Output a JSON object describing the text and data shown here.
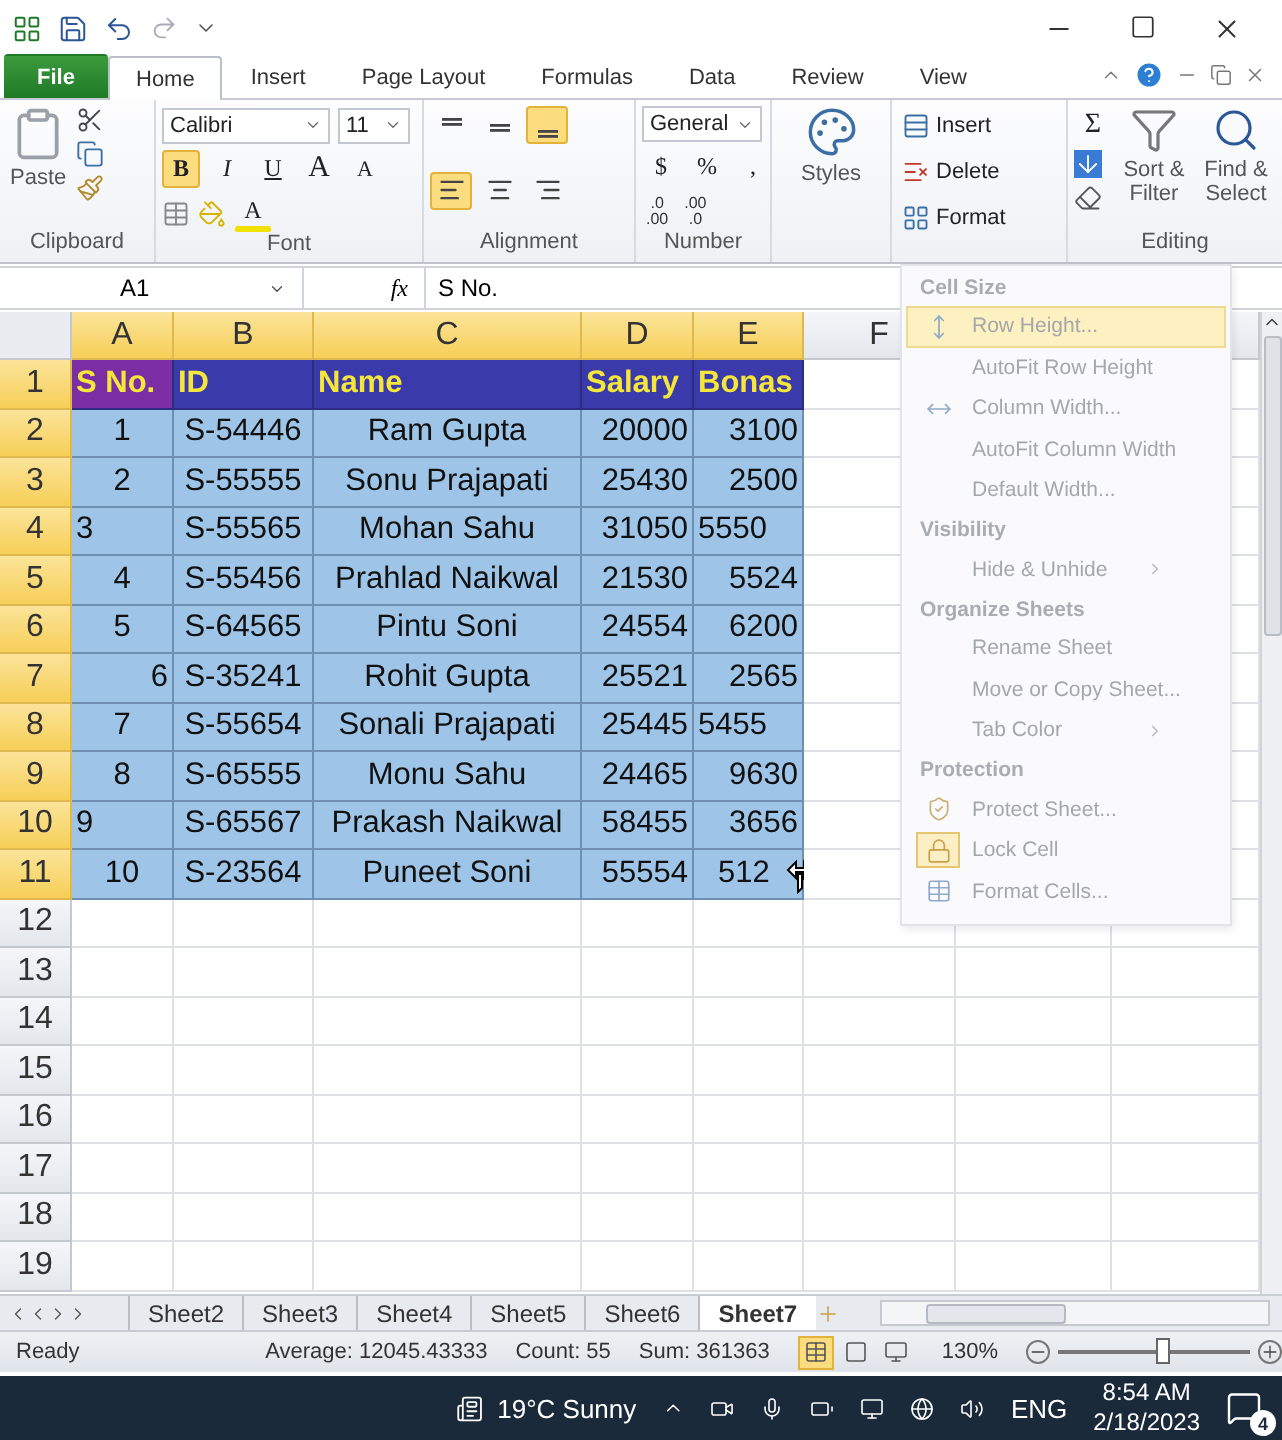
{
  "tabs": [
    {
      "label": "File",
      "kind": "file",
      "selected": false
    },
    {
      "label": "Home",
      "kind": "tab",
      "selected": true
    },
    {
      "label": "Insert",
      "kind": "tab",
      "selected": false
    },
    {
      "label": "Page Layout",
      "kind": "tab",
      "selected": false
    },
    {
      "label": "Formulas",
      "kind": "tab",
      "selected": false
    },
    {
      "label": "Data",
      "kind": "tab",
      "selected": false
    },
    {
      "label": "Review",
      "kind": "tab",
      "selected": false
    },
    {
      "label": "View",
      "kind": "tab",
      "selected": false
    }
  ],
  "ribbon": {
    "clipboard": {
      "label": "Clipboard",
      "paste": "Paste"
    },
    "font": {
      "label": "Font",
      "font_name": "Calibri",
      "font_size": "11",
      "bold": {
        "text": "B",
        "selected": true
      },
      "italic": {
        "text": "I",
        "selected": false
      },
      "underline": {
        "text": "U",
        "selected": false
      },
      "grow": "A",
      "shrink": "A",
      "font_color": "A"
    },
    "alignment": {
      "label": "Alignment",
      "buttons": [
        {
          "kind": "top",
          "selected": false
        },
        {
          "kind": "middle",
          "selected": false
        },
        {
          "kind": "bottom",
          "selected": true
        },
        {
          "kind": "left",
          "selected": true
        },
        {
          "kind": "center",
          "selected": false
        },
        {
          "kind": "right",
          "selected": false
        }
      ]
    },
    "number": {
      "label": "Number",
      "format": "General",
      "currency": "$",
      "percent": "%",
      "comma": ",",
      "decimals": [
        {
          "top": ".0",
          "bottom": ".00"
        },
        {
          "top": ".00",
          "bottom": ".0"
        }
      ]
    },
    "styles": {
      "label": "Styles"
    },
    "cells": {
      "items": [
        {
          "label": "Insert",
          "kind": "insert"
        },
        {
          "label": "Delete",
          "kind": "delete"
        },
        {
          "label": "Format",
          "kind": "format"
        }
      ]
    },
    "editing": {
      "label": "Editing",
      "sum": "Σ",
      "sort": "Sort & Filter",
      "find": "Find & Select"
    }
  },
  "name_box": "A1",
  "function_label": "fx",
  "formula": "S No.",
  "columns": [
    {
      "label": "A",
      "selected": true
    },
    {
      "label": "B",
      "selected": true
    },
    {
      "label": "C",
      "selected": true
    },
    {
      "label": "D",
      "selected": true
    },
    {
      "label": "E",
      "selected": true
    },
    {
      "label": "F",
      "selected": false
    }
  ],
  "rows": [
    {
      "number": "1",
      "selected": true,
      "kind": "header",
      "cells": [
        {
          "text": "S No.",
          "kind": "text",
          "active": true
        },
        {
          "text": "ID",
          "kind": "text",
          "active": false
        },
        {
          "text": "Name",
          "kind": "text",
          "active": false
        },
        {
          "text": "Salary",
          "kind": "text",
          "active": false
        },
        {
          "text": "Bonas",
          "kind": "text",
          "active": false
        }
      ]
    },
    {
      "number": "2",
      "selected": true,
      "kind": "data",
      "cells": [
        {
          "text": "1",
          "kind": "centered"
        },
        {
          "text": "S-54446",
          "kind": "centered"
        },
        {
          "text": "Ram Gupta",
          "kind": "centered"
        },
        {
          "text": "20000",
          "kind": "number"
        },
        {
          "text": "3100",
          "kind": "number"
        }
      ]
    },
    {
      "number": "3",
      "selected": true,
      "kind": "data",
      "cells": [
        {
          "text": "2",
          "kind": "centered"
        },
        {
          "text": "S-55555",
          "kind": "centered"
        },
        {
          "text": "Sonu Prajapati",
          "kind": "centered"
        },
        {
          "text": "25430",
          "kind": "number"
        },
        {
          "text": "2500",
          "kind": "number"
        }
      ]
    },
    {
      "number": "4",
      "selected": true,
      "kind": "data",
      "cells": [
        {
          "text": "3",
          "kind": "text"
        },
        {
          "text": "S-55565",
          "kind": "centered"
        },
        {
          "text": "Mohan Sahu",
          "kind": "centered"
        },
        {
          "text": "31050",
          "kind": "number"
        },
        {
          "text": "5550",
          "kind": "text"
        }
      ]
    },
    {
      "number": "5",
      "selected": true,
      "kind": "data",
      "cells": [
        {
          "text": "4",
          "kind": "centered"
        },
        {
          "text": "S-55456",
          "kind": "centered"
        },
        {
          "text": "Prahlad Naikwal",
          "kind": "centered"
        },
        {
          "text": "21530",
          "kind": "number"
        },
        {
          "text": "5524",
          "kind": "number"
        }
      ]
    },
    {
      "number": "6",
      "selected": true,
      "kind": "data",
      "cells": [
        {
          "text": "5",
          "kind": "centered"
        },
        {
          "text": "S-64565",
          "kind": "centered"
        },
        {
          "text": "Pintu Soni",
          "kind": "centered"
        },
        {
          "text": "24554",
          "kind": "number"
        },
        {
          "text": "6200",
          "kind": "number"
        }
      ]
    },
    {
      "number": "7",
      "selected": true,
      "kind": "data",
      "cells": [
        {
          "text": "6",
          "kind": "number"
        },
        {
          "text": "S-35241",
          "kind": "centered"
        },
        {
          "text": "Rohit Gupta",
          "kind": "centered"
        },
        {
          "text": "25521",
          "kind": "number"
        },
        {
          "text": "2565",
          "kind": "number"
        }
      ]
    },
    {
      "number": "8",
      "selected": true,
      "kind": "data",
      "cells": [
        {
          "text": "7",
          "kind": "centered"
        },
        {
          "text": "S-55654",
          "kind": "centered"
        },
        {
          "text": "Sonali Prajapati",
          "kind": "centered"
        },
        {
          "text": "25445",
          "kind": "number"
        },
        {
          "text": "5455",
          "kind": "text"
        }
      ]
    },
    {
      "number": "9",
      "selected": true,
      "kind": "data",
      "cells": [
        {
          "text": "8",
          "kind": "centered"
        },
        {
          "text": "S-65555",
          "kind": "centered"
        },
        {
          "text": "Monu Sahu",
          "kind": "centered"
        },
        {
          "text": "24465",
          "kind": "number"
        },
        {
          "text": "9630",
          "kind": "number"
        }
      ]
    },
    {
      "number": "10",
      "selected": true,
      "kind": "data",
      "cells": [
        {
          "text": "9",
          "kind": "text"
        },
        {
          "text": "S-65567",
          "kind": "centered"
        },
        {
          "text": "Prakash Naikwal",
          "kind": "centered"
        },
        {
          "text": "58455",
          "kind": "number"
        },
        {
          "text": "3656",
          "kind": "number"
        }
      ]
    },
    {
      "number": "11",
      "selected": true,
      "kind": "data",
      "cells": [
        {
          "text": "10",
          "kind": "centered"
        },
        {
          "text": "S-23564",
          "kind": "centered"
        },
        {
          "text": "Puneet Soni",
          "kind": "centered"
        },
        {
          "text": "55554",
          "kind": "number"
        },
        {
          "text": "512",
          "kind": "number"
        }
      ]
    },
    {
      "number": "12",
      "selected": false,
      "kind": "empty"
    },
    {
      "number": "13",
      "selected": false,
      "kind": "empty"
    },
    {
      "number": "14",
      "selected": false,
      "kind": "empty"
    },
    {
      "number": "15",
      "selected": false,
      "kind": "empty"
    },
    {
      "number": "16",
      "selected": false,
      "kind": "empty"
    },
    {
      "number": "17",
      "selected": false,
      "kind": "empty"
    },
    {
      "number": "18",
      "selected": false,
      "kind": "empty"
    },
    {
      "number": "19",
      "selected": false,
      "kind": "empty"
    }
  ],
  "format_menu": {
    "sections": [
      {
        "heading": "Cell Size",
        "items": [
          {
            "label": "Row Height...",
            "kind": "height",
            "selected": true,
            "checked": false,
            "submenu": false
          },
          {
            "label": "AutoFit Row Height",
            "kind": "plain",
            "selected": false,
            "checked": false,
            "submenu": false
          },
          {
            "label": "Column Width...",
            "kind": "width",
            "selected": false,
            "checked": false,
            "submenu": false
          },
          {
            "label": "AutoFit Column Width",
            "kind": "plain",
            "selected": false,
            "checked": false,
            "submenu": false
          },
          {
            "label": "Default Width...",
            "kind": "plain",
            "selected": false,
            "checked": false,
            "submenu": false
          }
        ]
      },
      {
        "heading": "Visibility",
        "items": [
          {
            "label": "Hide & Unhide",
            "kind": "plain",
            "selected": false,
            "checked": false,
            "submenu": true
          }
        ]
      },
      {
        "heading": "Organize Sheets",
        "items": [
          {
            "label": "Rename Sheet",
            "kind": "plain",
            "selected": false,
            "checked": false,
            "submenu": false
          },
          {
            "label": "Move or Copy Sheet...",
            "kind": "plain",
            "selected": false,
            "checked": false,
            "submenu": false
          },
          {
            "label": "Tab Color",
            "kind": "plain",
            "selected": false,
            "checked": false,
            "submenu": true
          }
        ]
      },
      {
        "heading": "Protection",
        "items": [
          {
            "label": "Protect Sheet...",
            "kind": "protect",
            "selected": false,
            "checked": false,
            "submenu": false
          },
          {
            "label": "Lock Cell",
            "kind": "lock",
            "selected": false,
            "checked": true,
            "submenu": false
          },
          {
            "label": "Format Cells...",
            "kind": "format",
            "selected": false,
            "checked": false,
            "submenu": false
          }
        ]
      }
    ]
  },
  "sheets": [
    {
      "label": "Sheet2",
      "selected": false
    },
    {
      "label": "Sheet3",
      "selected": false
    },
    {
      "label": "Sheet4",
      "selected": false
    },
    {
      "label": "Sheet5",
      "selected": false
    },
    {
      "label": "Sheet6",
      "selected": false
    },
    {
      "label": "Sheet7",
      "selected": true
    }
  ],
  "status_bar": {
    "mode": "Ready",
    "average": "Average: 12045.43333",
    "count": "Count: 55",
    "sum": "Sum: 361363",
    "zoom": {
      "reading": "130%",
      "level": 0.54
    }
  },
  "taskbar": {
    "weather": "19°C  Sunny",
    "language": "ENG",
    "time": "8:54 AM",
    "date": "2/18/2023",
    "notifications": "4"
  }
}
